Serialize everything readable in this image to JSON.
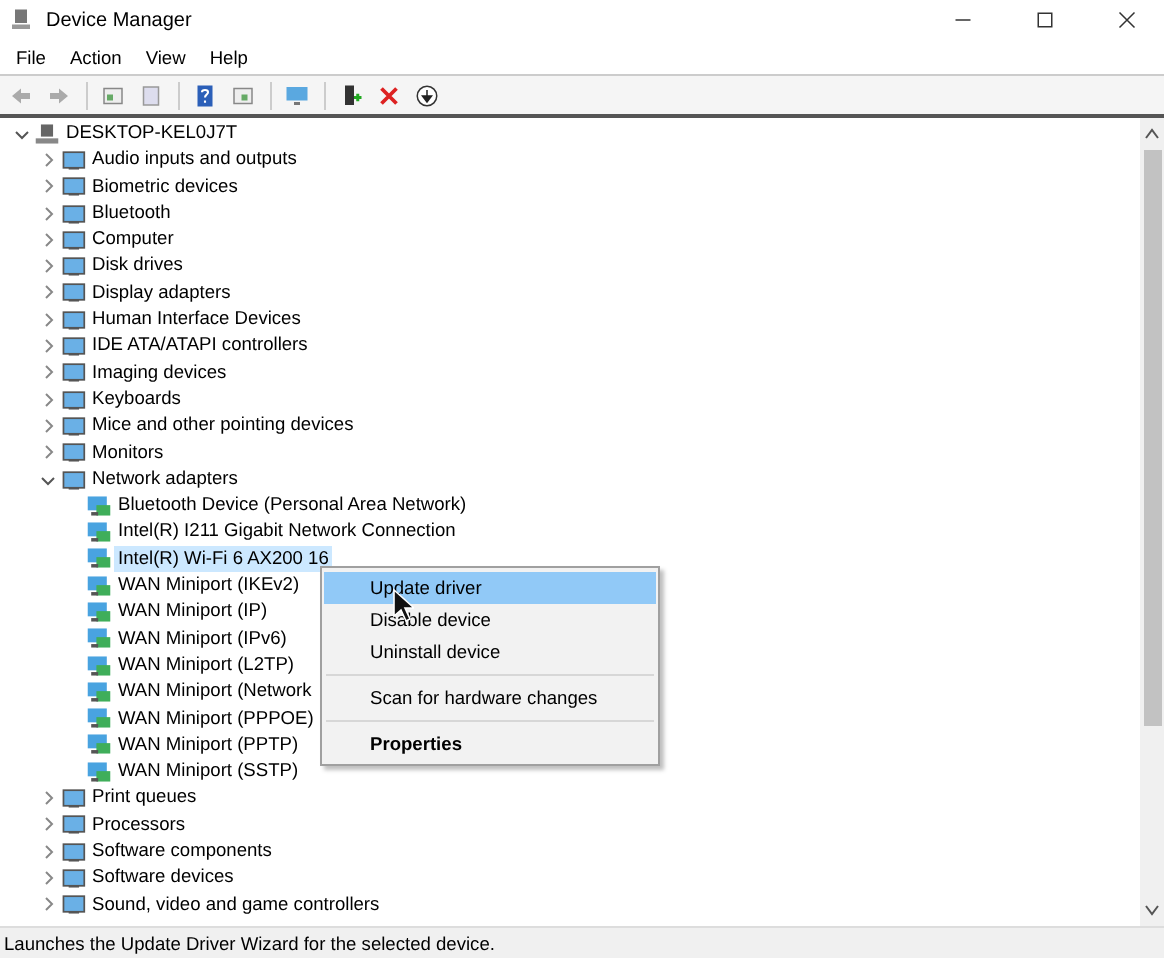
{
  "window": {
    "title": "Device Manager"
  },
  "menu_bar": [
    {
      "label": "File"
    },
    {
      "label": "Action"
    },
    {
      "label": "View"
    },
    {
      "label": "Help"
    }
  ],
  "tree": {
    "label": "DESKTOP-KEL0J7T",
    "expanded": true,
    "selected": false,
    "children": [
      {
        "label": "Audio inputs and outputs",
        "expanded": false,
        "selected": false
      },
      {
        "label": "Biometric devices",
        "expanded": false,
        "selected": false
      },
      {
        "label": "Bluetooth",
        "expanded": false,
        "selected": false
      },
      {
        "label": "Computer",
        "expanded": false,
        "selected": false
      },
      {
        "label": "Disk drives",
        "expanded": false,
        "selected": false
      },
      {
        "label": "Display adapters",
        "expanded": false,
        "selected": false
      },
      {
        "label": "Human Interface Devices",
        "expanded": false,
        "selected": false
      },
      {
        "label": "IDE ATA/ATAPI controllers",
        "expanded": false,
        "selected": false
      },
      {
        "label": "Imaging devices",
        "expanded": false,
        "selected": false
      },
      {
        "label": "Keyboards",
        "expanded": false,
        "selected": false
      },
      {
        "label": "Mice and other pointing devices",
        "expanded": false,
        "selected": false
      },
      {
        "label": "Monitors",
        "expanded": false,
        "selected": false
      },
      {
        "label": "Network adapters",
        "expanded": true,
        "selected": false,
        "children": [
          {
            "label": "Bluetooth Device (Personal Area Network)",
            "selected": false
          },
          {
            "label": "Intel(R) I211 Gigabit Network Connection",
            "selected": false
          },
          {
            "label": "Intel(R) Wi-Fi 6 AX200 16",
            "selected": true
          },
          {
            "label": "WAN Miniport (IKEv2)",
            "selected": false
          },
          {
            "label": "WAN Miniport (IP)",
            "selected": false
          },
          {
            "label": "WAN Miniport (IPv6)",
            "selected": false
          },
          {
            "label": "WAN Miniport (L2TP)",
            "selected": false
          },
          {
            "label": "WAN Miniport (Network",
            "selected": false
          },
          {
            "label": "WAN Miniport (PPPOE)",
            "selected": false
          },
          {
            "label": "WAN Miniport (PPTP)",
            "selected": false
          },
          {
            "label": "WAN Miniport (SSTP)",
            "selected": false
          }
        ]
      },
      {
        "label": "Print queues",
        "expanded": false,
        "selected": false
      },
      {
        "label": "Processors",
        "expanded": false,
        "selected": false
      },
      {
        "label": "Software components",
        "expanded": false,
        "selected": false
      },
      {
        "label": "Software devices",
        "expanded": false,
        "selected": false
      },
      {
        "label": "Sound, video and game controllers",
        "expanded": false,
        "selected": false
      }
    ]
  },
  "context_menu": {
    "items": [
      {
        "kind": "item",
        "label": "Update driver",
        "selected": true,
        "default": false
      },
      {
        "kind": "item",
        "label": "Disable device",
        "selected": false,
        "default": false
      },
      {
        "kind": "item",
        "label": "Uninstall device",
        "selected": false,
        "default": false
      },
      {
        "kind": "separator"
      },
      {
        "kind": "item",
        "label": "Scan for hardware changes",
        "selected": false,
        "default": false
      },
      {
        "kind": "separator"
      },
      {
        "kind": "item",
        "label": "Properties",
        "selected": false,
        "default": true
      }
    ]
  },
  "status_bar": {
    "text": "Launches the Update Driver Wizard for the selected device."
  }
}
